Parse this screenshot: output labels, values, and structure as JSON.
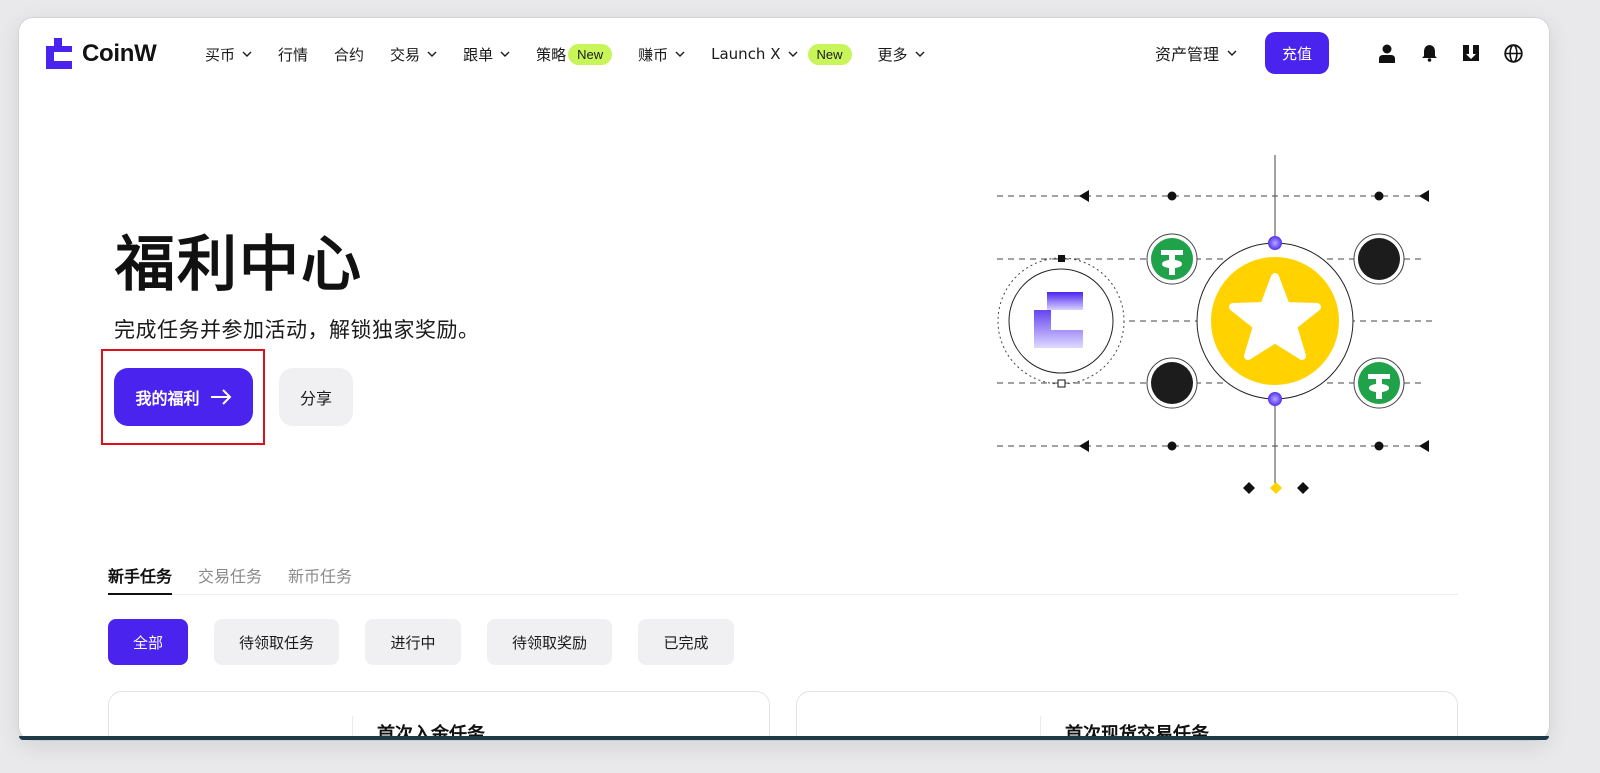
{
  "brand": {
    "name": "CoinW",
    "accent": "#4b23ee",
    "new_badge_color": "#c8f55a"
  },
  "nav": {
    "items": [
      {
        "label": "买币",
        "dropdown": true
      },
      {
        "label": "行情",
        "dropdown": false
      },
      {
        "label": "合约",
        "dropdown": false
      },
      {
        "label": "交易",
        "dropdown": true
      },
      {
        "label": "跟单",
        "dropdown": true
      },
      {
        "label": "策略",
        "dropdown": false,
        "badge": "New"
      },
      {
        "label": "赚币",
        "dropdown": true
      },
      {
        "label": "Launch X",
        "dropdown": true,
        "badge": "New"
      },
      {
        "label": "更多",
        "dropdown": true
      }
    ],
    "assets_label": "资产管理",
    "deposit_label": "充值",
    "icons": [
      "user-icon",
      "bell-icon",
      "download-icon",
      "globe-icon"
    ]
  },
  "hero": {
    "title": "福利中心",
    "subtitle": "完成任务并参加活动，解锁独家奖励。",
    "primary_button": "我的福利",
    "secondary_button": "分享"
  },
  "tabs": [
    {
      "label": "新手任务",
      "active": true
    },
    {
      "label": "交易任务",
      "active": false
    },
    {
      "label": "新币任务",
      "active": false
    }
  ],
  "filters": [
    {
      "label": "全部",
      "active": true
    },
    {
      "label": "待领取任务",
      "active": false
    },
    {
      "label": "进行中",
      "active": false
    },
    {
      "label": "待领取奖励",
      "active": false
    },
    {
      "label": "已完成",
      "active": false
    }
  ],
  "cards": [
    {
      "title": "首次入金任务"
    },
    {
      "title": "首次现货交易任务"
    }
  ]
}
